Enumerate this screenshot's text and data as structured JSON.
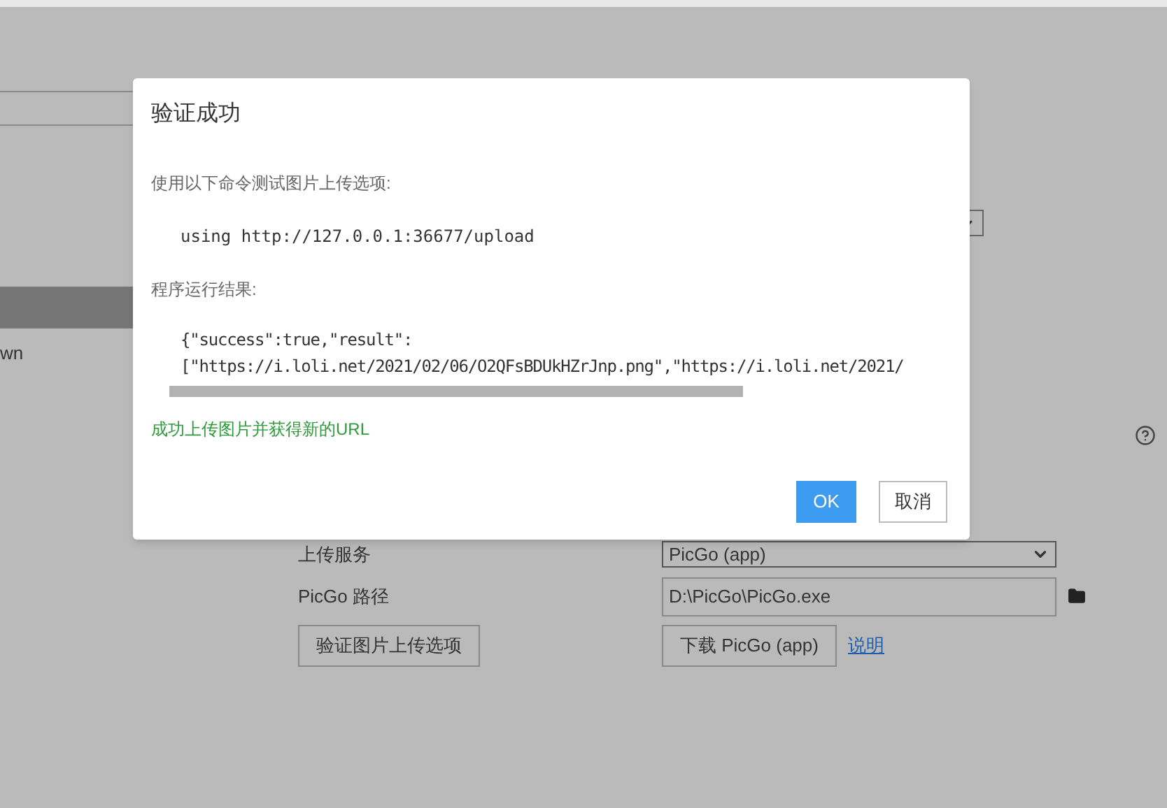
{
  "background": {
    "left_text": "wn",
    "form": [
      {
        "label": "上传服务",
        "kind": "select",
        "value": "PicGo (app)"
      },
      {
        "label": "PicGo 路径",
        "kind": "path",
        "value": "D:\\PicGo\\PicGo.exe"
      }
    ],
    "verify_button": "验证图片上传选项",
    "download_button": "下载 PicGo (app)",
    "help_link": "说明"
  },
  "dialog": {
    "title": "验证成功",
    "intro": "使用以下命令测试图片上传选项:",
    "command": "using http://127.0.0.1:36677/upload",
    "result_label": "程序运行结果:",
    "result_lines": [
      "{\"success\":true,\"result\":",
      "[\"https://i.loli.net/2021/02/06/O2QFsBDUkHZrJnp.png\",\"https://i.loli.net/2021/"
    ],
    "success_message": "成功上传图片并获得新的URL",
    "ok_button": "OK",
    "cancel_button": "取消"
  }
}
